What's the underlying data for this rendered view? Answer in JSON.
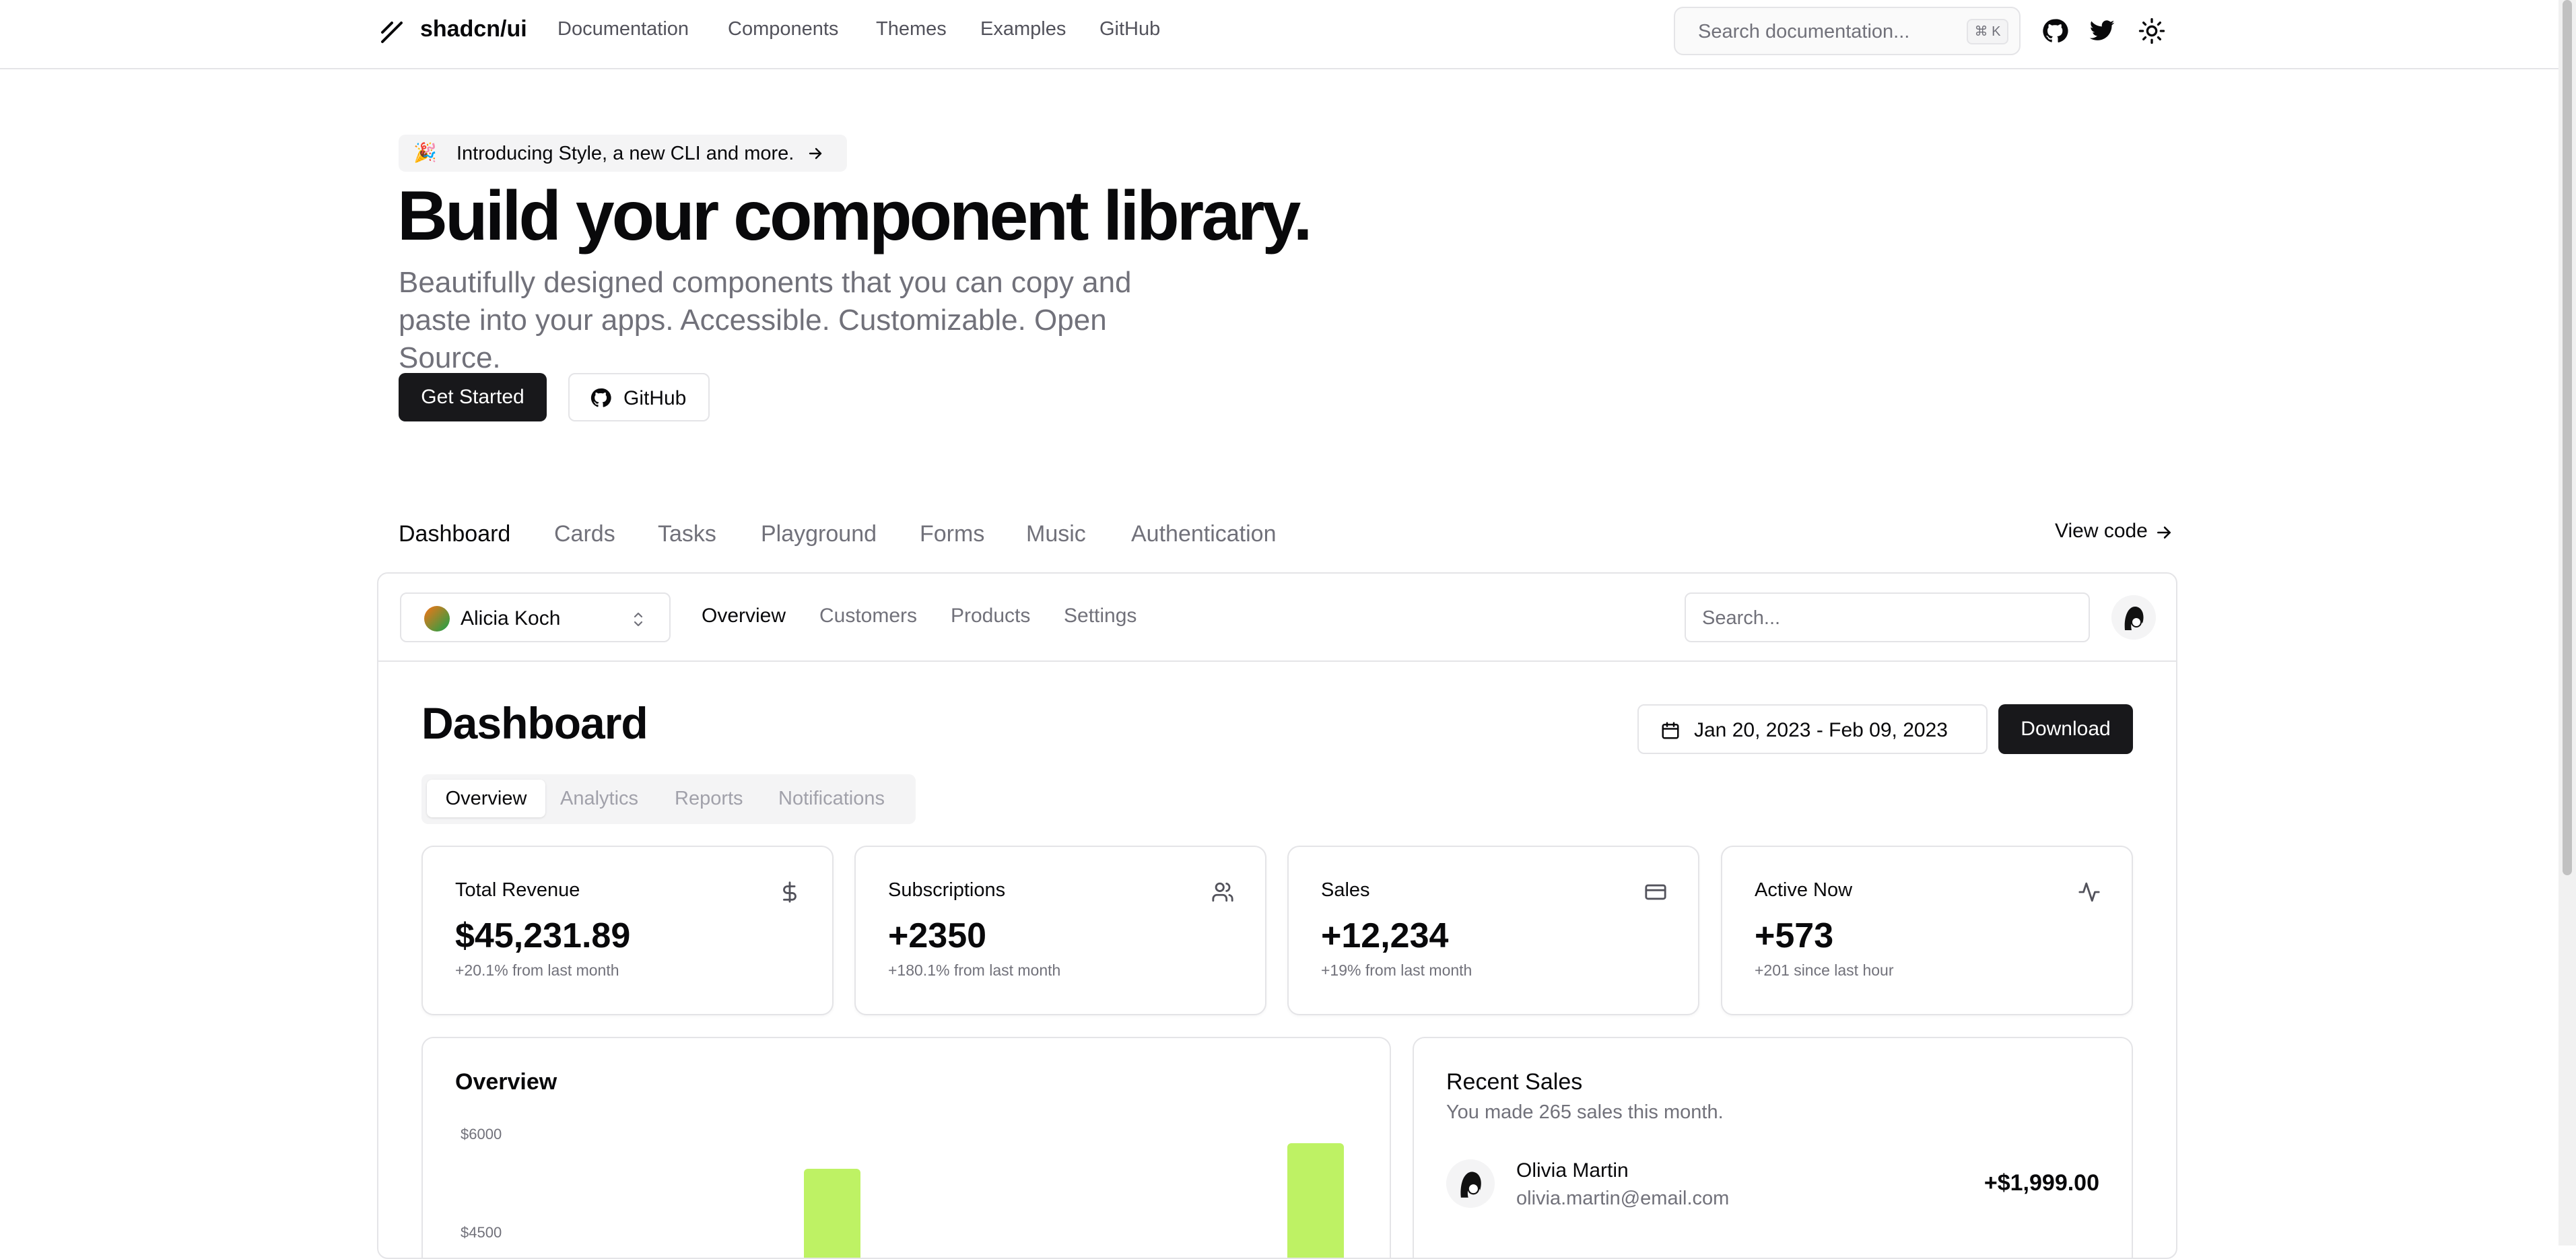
{
  "header": {
    "brand": "shadcn/ui",
    "nav": [
      "Documentation",
      "Components",
      "Themes",
      "Examples",
      "GitHub"
    ],
    "search_placeholder": "Search documentation...",
    "search_shortcut": "⌘ K"
  },
  "hero": {
    "announcement": "Introducing Style, a new CLI and more.",
    "announcement_emoji": "🎉",
    "title": "Build your component library.",
    "subtitle_line1": "Beautifully designed components that you can copy and",
    "subtitle_line2": "paste into your apps. Accessible. Customizable. Open Source.",
    "primary_button": "Get Started",
    "secondary_button": "GitHub"
  },
  "examples": {
    "tabs": [
      "Dashboard",
      "Cards",
      "Tasks",
      "Playground",
      "Forms",
      "Music",
      "Authentication"
    ],
    "active_tab": "Dashboard",
    "view_code": "View code"
  },
  "demo": {
    "team": "Alicia Koch",
    "nav": [
      "Overview",
      "Customers",
      "Products",
      "Settings"
    ],
    "search_placeholder": "Search...",
    "title": "Dashboard",
    "date_range": "Jan 20, 2023 - Feb 09, 2023",
    "download": "Download",
    "sub_tabs": [
      "Overview",
      "Analytics",
      "Reports",
      "Notifications"
    ],
    "cards": [
      {
        "title": "Total Revenue",
        "value": "$45,231.89",
        "sub": "+20.1% from last month",
        "icon": "dollar-icon"
      },
      {
        "title": "Subscriptions",
        "value": "+2350",
        "sub": "+180.1% from last month",
        "icon": "users-icon"
      },
      {
        "title": "Sales",
        "value": "+12,234",
        "sub": "+19% from last month",
        "icon": "credit-card-icon"
      },
      {
        "title": "Active Now",
        "value": "+573",
        "sub": "+201 since last hour",
        "icon": "activity-icon"
      }
    ],
    "overview": {
      "title": "Overview",
      "y_ticks": [
        "$6000",
        "$4500"
      ],
      "bar_values": [
        5600,
        6000
      ]
    },
    "recent_sales": {
      "title": "Recent Sales",
      "subtitle": "You made 265 sales this month.",
      "rows": [
        {
          "name": "Olivia Martin",
          "email": "olivia.martin@email.com",
          "amount": "+$1,999.00"
        }
      ]
    }
  },
  "colors": {
    "bar": "#bef264",
    "primary": "#18181b",
    "muted": "#71717a",
    "border": "#e4e4e7"
  }
}
